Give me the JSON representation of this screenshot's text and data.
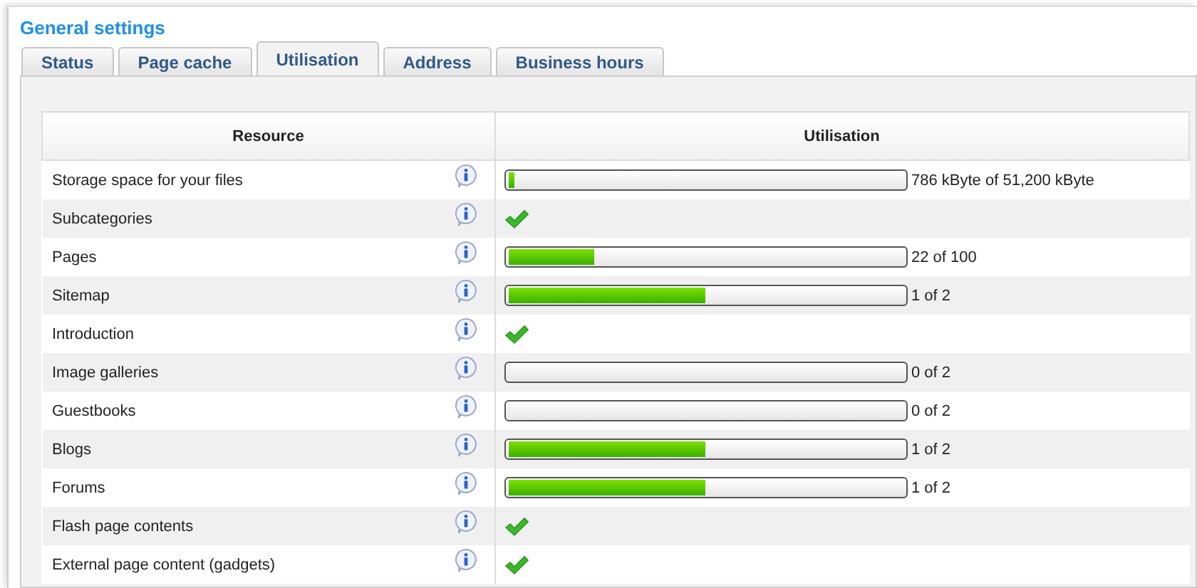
{
  "title": "General settings",
  "tabs": [
    {
      "label": "Status",
      "selected": false
    },
    {
      "label": "Page cache",
      "selected": false
    },
    {
      "label": "Utilisation",
      "selected": true
    },
    {
      "label": "Address",
      "selected": false
    },
    {
      "label": "Business hours",
      "selected": false
    }
  ],
  "table": {
    "columns": [
      "Resource",
      "Utilisation"
    ],
    "rows": [
      {
        "resource": "Storage space for your files",
        "kind": "bar",
        "level": 0.015,
        "reading": "786 kByte of 51,200 kByte"
      },
      {
        "resource": "Subcategories",
        "kind": "check"
      },
      {
        "resource": "Pages",
        "kind": "bar",
        "level": 0.22,
        "reading": "22 of 100"
      },
      {
        "resource": "Sitemap",
        "kind": "bar",
        "level": 0.5,
        "reading": "1 of 2"
      },
      {
        "resource": "Introduction",
        "kind": "check"
      },
      {
        "resource": "Image galleries",
        "kind": "bar",
        "level": 0,
        "reading": "0 of 2"
      },
      {
        "resource": "Guestbooks",
        "kind": "bar",
        "level": 0,
        "reading": "0 of 2"
      },
      {
        "resource": "Blogs",
        "kind": "bar",
        "level": 0.5,
        "reading": "1 of 2"
      },
      {
        "resource": "Forums",
        "kind": "bar",
        "level": 0.5,
        "reading": "1 of 2"
      },
      {
        "resource": "Flash page contents",
        "kind": "check"
      },
      {
        "resource": "External page content (gadgets)",
        "kind": "check"
      }
    ]
  }
}
